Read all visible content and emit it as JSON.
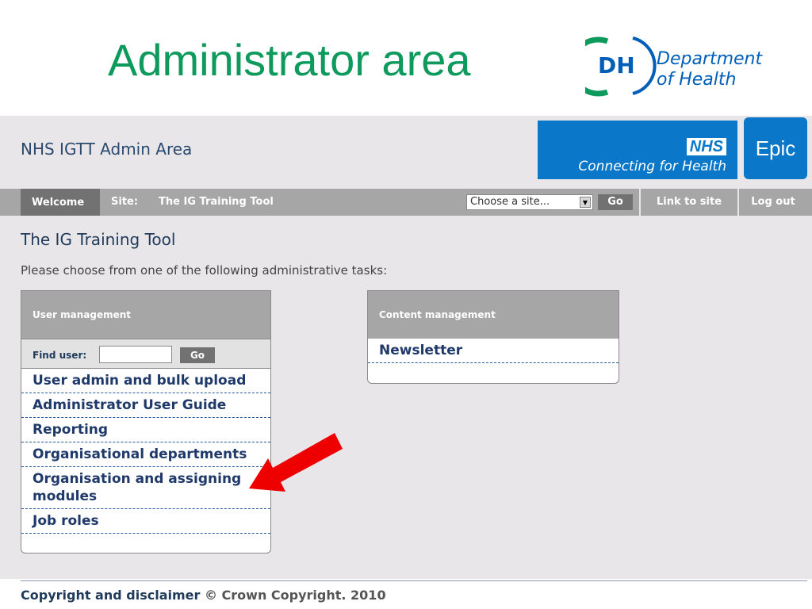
{
  "slide": {
    "title": "Administrator area",
    "logo_text": "DH",
    "logo_name_line1": "Department",
    "logo_name_line2": "of Health"
  },
  "header": {
    "app_title": "NHS IGTT Admin Area",
    "nhs_logo": "NHS",
    "nhs_tagline": "Connecting for Health",
    "epic_label": "Epic"
  },
  "nav": {
    "welcome": "Welcome",
    "site_label": "Site:",
    "site_name": "The IG Training Tool",
    "site_select_value": "Choose a site...",
    "go_label": "Go",
    "link_to_site": "Link to site",
    "log_out": "Log out"
  },
  "main": {
    "section_title": "The IG Training Tool",
    "instructions": "Please choose from one of the following administrative tasks:"
  },
  "user_management": {
    "heading": "User management",
    "find_label": "Find user:",
    "find_value": "",
    "go_label": "Go",
    "links": [
      "User admin and bulk upload",
      "Administrator User Guide",
      "Reporting",
      "Organisational departments",
      "Organisation and assigning modules",
      "Job roles"
    ]
  },
  "content_management": {
    "heading": "Content management",
    "links": [
      "Newsletter"
    ]
  },
  "colors": {
    "title_green": "#0d9a5c",
    "nhs_blue": "#0a77c8",
    "arrow_red": "#ee0000"
  },
  "footer": {
    "link": "Copyright and disclaimer",
    "copyright": "© Crown Copyright. 2010"
  }
}
